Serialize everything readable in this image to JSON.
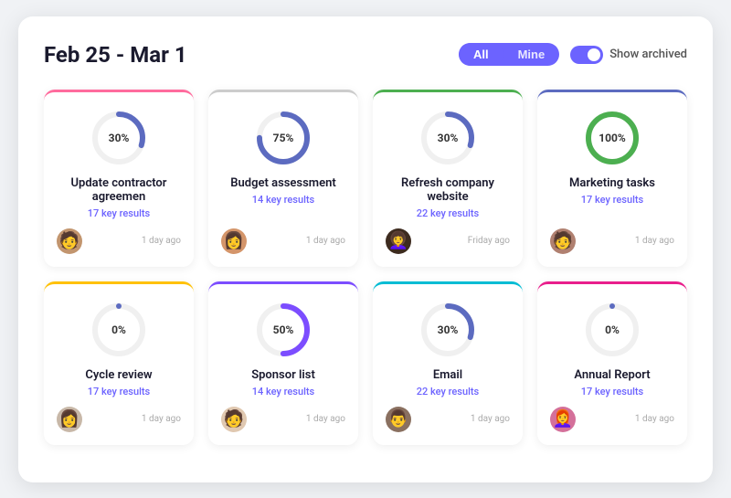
{
  "header": {
    "title": "Feb 25 - Mar 1",
    "filter": {
      "all_label": "All",
      "mine_label": "Mine",
      "toggle_label": "Show archived"
    }
  },
  "cards": [
    {
      "id": "card-1",
      "title": "Update contractor agreemen",
      "key_results": "17 key results",
      "percent": 30,
      "time": "1 day ago",
      "border": "border-pink",
      "ring_color": "ring-blue",
      "avatar_class": "av1",
      "avatar_emoji": "👤"
    },
    {
      "id": "card-2",
      "title": "Budget assessment",
      "key_results": "14 key results",
      "percent": 75,
      "time": "1 day ago",
      "border": "border-gray",
      "ring_color": "ring-blue",
      "avatar_class": "av2",
      "avatar_emoji": "👤"
    },
    {
      "id": "card-3",
      "title": "Refresh company website",
      "key_results": "22 key results",
      "percent": 30,
      "time": "Friday ago",
      "border": "border-green",
      "ring_color": "ring-blue",
      "avatar_class": "av3",
      "avatar_emoji": "👤"
    },
    {
      "id": "card-4",
      "title": "Marketing tasks",
      "key_results": "17 key results",
      "percent": 100,
      "time": "1 day ago",
      "border": "border-indigo",
      "ring_color": "ring-green",
      "avatar_class": "av4",
      "avatar_emoji": "👤"
    },
    {
      "id": "card-5",
      "title": "Cycle review",
      "key_results": "17 key results",
      "percent": 0,
      "time": "1 day ago",
      "border": "border-yellow",
      "ring_color": "ring-blue",
      "avatar_class": "av5",
      "avatar_emoji": "👤"
    },
    {
      "id": "card-6",
      "title": "Sponsor list",
      "key_results": "14 key results",
      "percent": 50,
      "time": "1 day ago",
      "border": "border-purple",
      "ring_color": "ring-purple",
      "avatar_class": "av6",
      "avatar_emoji": "👤"
    },
    {
      "id": "card-7",
      "title": "Email",
      "key_results": "22 key results",
      "percent": 30,
      "time": "1 day ago",
      "border": "border-cyan",
      "ring_color": "ring-blue",
      "avatar_class": "av7",
      "avatar_emoji": "👤"
    },
    {
      "id": "card-8",
      "title": "Annual Report",
      "key_results": "17 key results",
      "percent": 0,
      "time": "1 day ago",
      "border": "border-magenta",
      "ring_color": "ring-blue",
      "avatar_class": "av8",
      "avatar_emoji": "👤"
    }
  ]
}
